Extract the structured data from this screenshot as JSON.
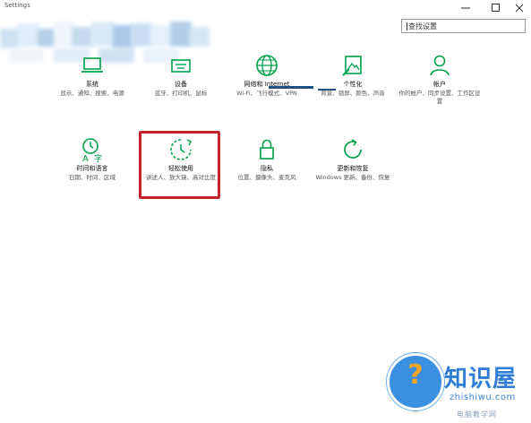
{
  "window": {
    "title": "Settings"
  },
  "search": {
    "value": "查找设置",
    "placeholder": ""
  },
  "settings": {
    "system": {
      "name": "系统",
      "desc": "显示、通知、搜索、电源"
    },
    "devices": {
      "name": "设备",
      "desc": "蓝牙、打印机、鼠标"
    },
    "network": {
      "name": "网络和 Internet",
      "desc": "Wi-Fi、飞行模式、VPN"
    },
    "personal": {
      "name": "个性化",
      "desc": "背景、锁屏、颜色、声音"
    },
    "accounts": {
      "name": "帐户",
      "desc": "你的帐户、同步设置、工作区设置"
    },
    "time": {
      "name": "时间和语言",
      "desc": "日期、时间、区域"
    },
    "ease": {
      "name": "轻松使用",
      "desc": "讲述人、放大镜、高对比度"
    },
    "privacy": {
      "name": "隐私",
      "desc": "位置、摄像头、麦克风"
    },
    "update": {
      "name": "更新和恢复",
      "desc": "Windows 更新、备份、恢复"
    }
  },
  "watermark": {
    "brand": "知识屋",
    "url": "zhishiwu.com",
    "footer": "电脑教学网"
  },
  "colors": {
    "accent": "#00a24a",
    "highlight": "#c4232b",
    "brand_blue": "#2f7dd6"
  }
}
